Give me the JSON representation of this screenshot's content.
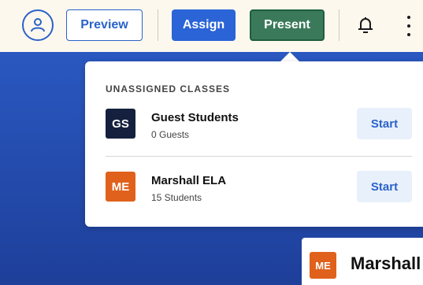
{
  "toolbar": {
    "avatar_icon": "students-icon",
    "preview_label": "Preview",
    "assign_label": "Assign",
    "present_label": "Present",
    "bell_icon": "bell-icon",
    "more_icon": "kebab-menu-icon"
  },
  "popover": {
    "section_title": "UNASSIGNED CLASSES",
    "classes": [
      {
        "badge": "GS",
        "name": "Guest Students",
        "sub": "0 Guests",
        "action": "Start",
        "badge_color": "#14203d"
      },
      {
        "badge": "ME",
        "name": "Marshall ELA",
        "sub": "15 Students",
        "action": "Start",
        "badge_color": "#e0611c"
      }
    ]
  },
  "background_card": {
    "badge": "ME",
    "name": "Marshall"
  },
  "colors": {
    "brand_blue": "#2a62c9",
    "present_green": "#3a7a5a",
    "backdrop": "#2a58c0"
  }
}
